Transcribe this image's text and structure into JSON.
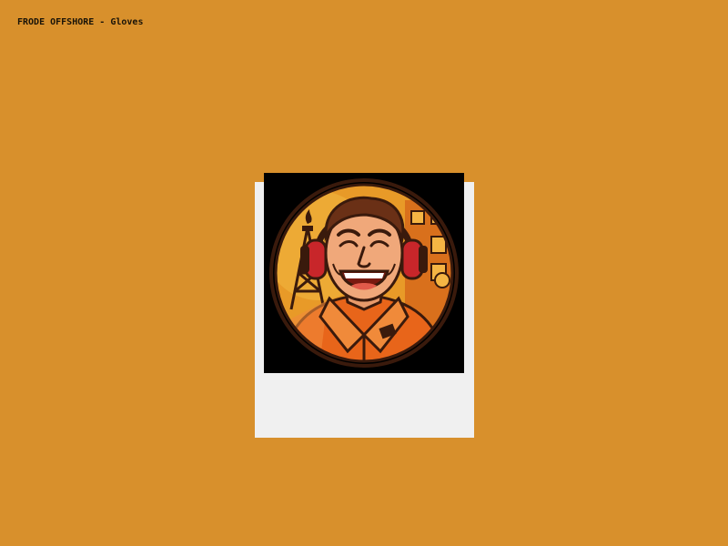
{
  "header": {
    "title": "FRODE OFFSHORE - Gloves"
  },
  "portrait": {
    "icon": "offshore-worker-portrait-icon"
  },
  "colors": {
    "background": "#d8902c",
    "card": "#f0f0f0",
    "portrait_bg": "#000000",
    "coverall": "#e8651a",
    "ear_defender": "#c8262a"
  }
}
